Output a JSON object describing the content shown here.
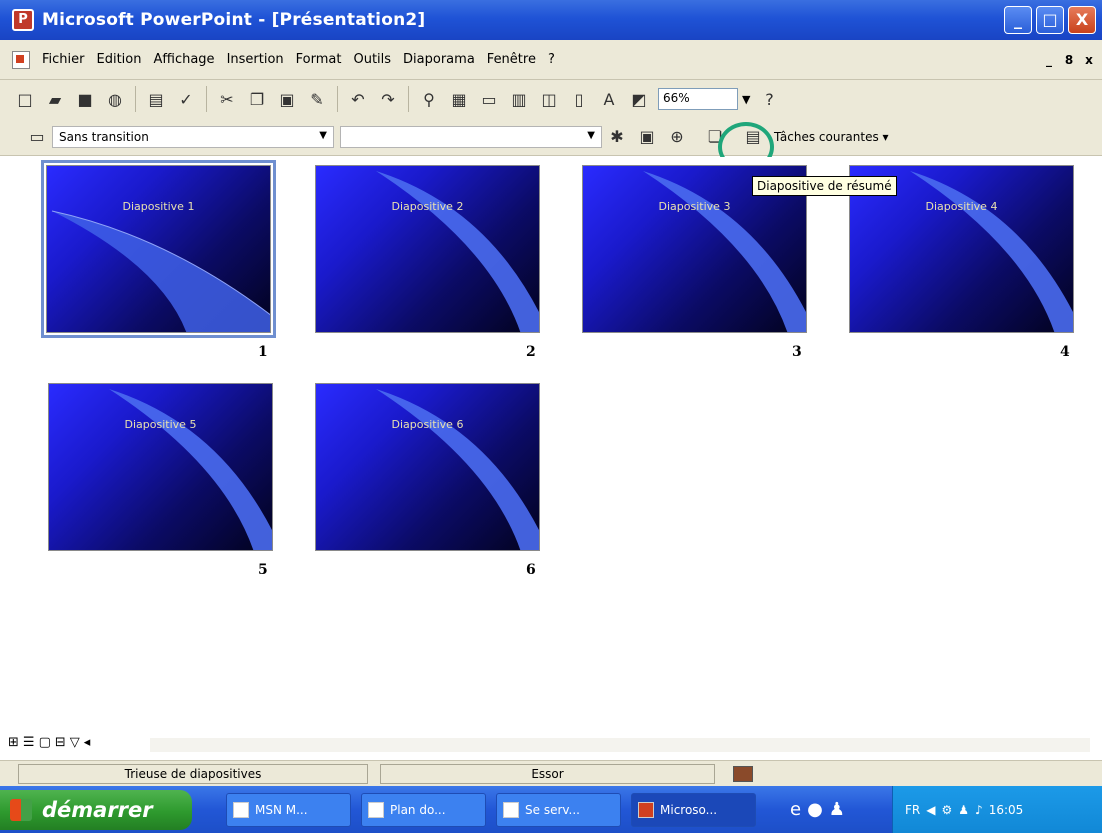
{
  "window": {
    "title": "Microsoft PowerPoint - [Présentation2]",
    "minimize": "_",
    "maximize": "□",
    "close": "X"
  },
  "menu": {
    "items": [
      "Fichier",
      "Edition",
      "Affichage",
      "Insertion",
      "Format",
      "Outils",
      "Diaporama",
      "Fenêtre",
      "?"
    ],
    "mdi": [
      "_",
      "8",
      "x"
    ]
  },
  "toolbar": {
    "zoom": "66%",
    "help_label": "?"
  },
  "toolbar2": {
    "transition_value": "Sans transition",
    "taches_label": "Tâches courantes",
    "tooltip": "Diapositive de résumé"
  },
  "slides": [
    {
      "title": "Diapositive 1",
      "number": "1"
    },
    {
      "title": "Diapositive 2",
      "number": "2"
    },
    {
      "title": "Diapositive 3",
      "number": "3"
    },
    {
      "title": "Diapositive 4",
      "number": "4"
    },
    {
      "title": "Diapositive 5",
      "number": "5"
    },
    {
      "title": "Diapositive 6",
      "number": "6"
    }
  ],
  "status": {
    "view": "Trieuse de diapositives",
    "design": "Essor"
  },
  "taskbar": {
    "start": "démarrer",
    "tasks": [
      "MSN M...",
      "Plan do...",
      "Se serv...",
      "Microso..."
    ],
    "lang": "FR",
    "clock": "16:05"
  },
  "colors": {
    "title_bar": "#1f53d6",
    "slide_dark": "#02021c",
    "slide_blue": "#2a2bff",
    "highlight_circle": "#1fa67a"
  }
}
